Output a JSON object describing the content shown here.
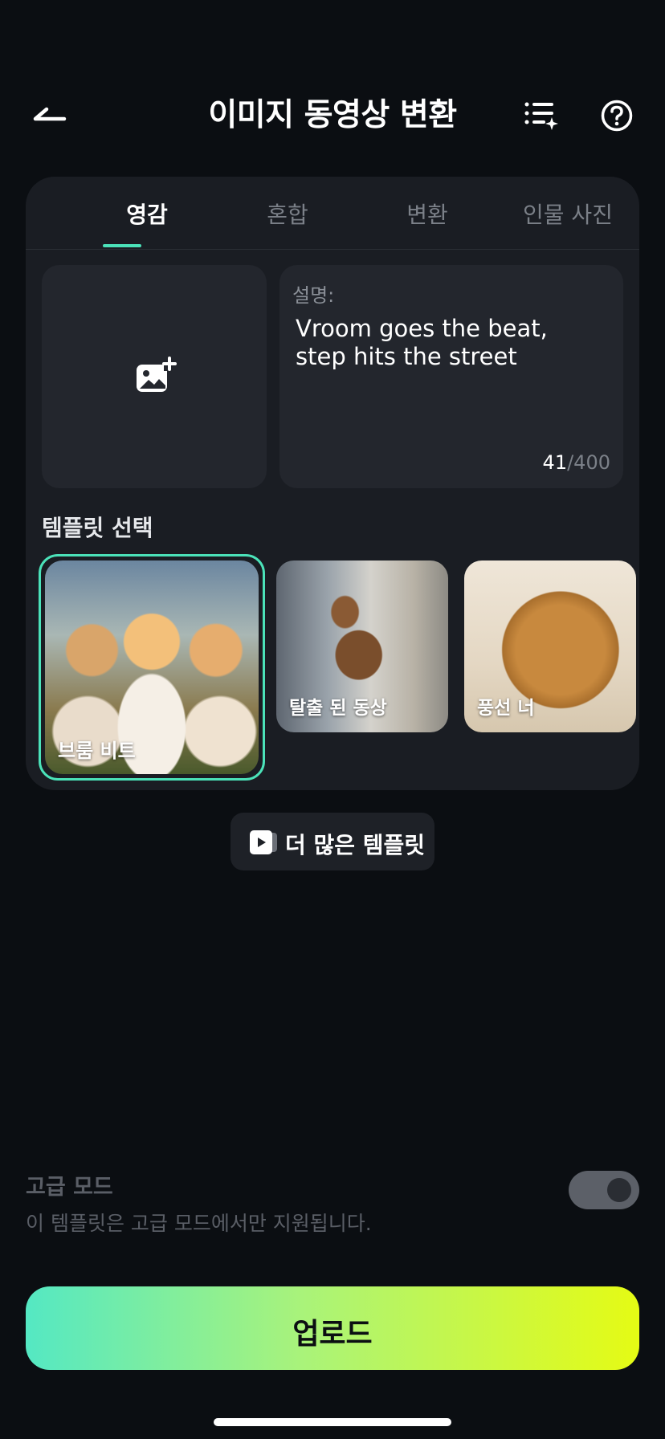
{
  "header": {
    "title": "이미지 동영상 변환"
  },
  "tabs": [
    {
      "label": "영감",
      "active": true
    },
    {
      "label": "혼합",
      "active": false
    },
    {
      "label": "변환",
      "active": false
    },
    {
      "label": "인물 사진",
      "active": false
    }
  ],
  "description": {
    "label": "설명:",
    "text": "Vroom goes the beat, step hits the street",
    "count": "41",
    "max": "/400"
  },
  "templates": {
    "heading": "템플릿 선택",
    "items": [
      {
        "label": "브룸 비트",
        "selected": true
      },
      {
        "label": "탈출 된 동상",
        "selected": false
      },
      {
        "label": "풍선 너",
        "selected": false
      }
    ],
    "more_label": "더 많은 템플릿"
  },
  "advanced": {
    "title": "고급 모드",
    "description": "이 템플릿은 고급 모드에서만 지원됩니다."
  },
  "upload_label": "업로드",
  "colors": {
    "accent": "#4be2b9",
    "background": "#0b0e12",
    "card": "#1a1d23",
    "gradient_start": "#54e8c3",
    "gradient_end": "#e5fb14"
  }
}
